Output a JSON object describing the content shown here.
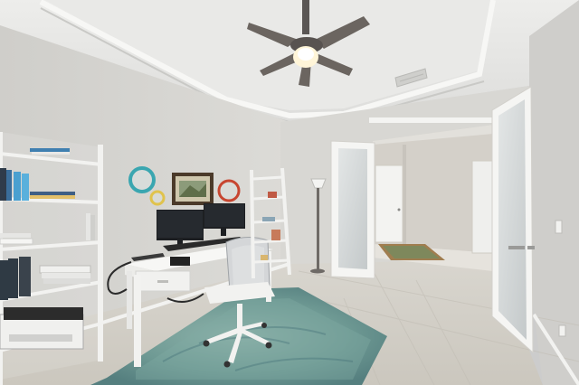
{
  "scene": {
    "kind": "home-office-room-photo",
    "palette": {
      "wall": "#d9d8d4",
      "wall_shadow": "#c6c5c1",
      "ceiling": "#e6e6e4",
      "floor": "#d3d0c8",
      "trim": "#f4f4f2",
      "rug": "#6f9a94",
      "monitor": "#1d1f22",
      "door_glass": "#cfd3d3"
    },
    "objects": [
      "ceiling-fan",
      "air-vent",
      "tray-ceiling-molding",
      "left-ladder-bookshelf",
      "printer",
      "round-mirror-teal",
      "framed-picture",
      "round-mirror-red",
      "small-round-mirror-yellow",
      "writing-desk",
      "dual-monitors",
      "office-chair",
      "area-rug",
      "ladder-shelf-corner",
      "floor-lamp",
      "french-door-left",
      "french-door-right",
      "hallway",
      "front-door",
      "hall-runner-rug",
      "wall-outlet",
      "light-switch"
    ]
  }
}
